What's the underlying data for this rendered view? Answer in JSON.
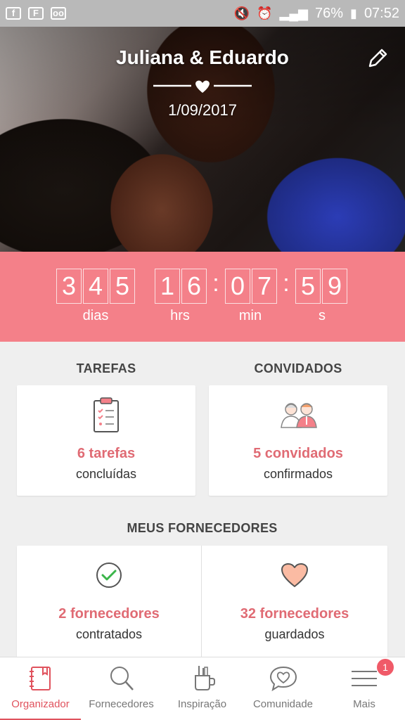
{
  "status_bar": {
    "battery": "76%",
    "time": "07:52",
    "left_icons": [
      "facebook-icon",
      "flipboard-icon",
      "voicemail-icon"
    ],
    "right_icons": [
      "mute-icon",
      "alarm-icon",
      "data-icon",
      "signal-icon",
      "battery-icon"
    ]
  },
  "hero": {
    "couple": "Juliana & Eduardo",
    "date": "1/09/2017"
  },
  "countdown": {
    "days_digits": [
      "3",
      "4",
      "5"
    ],
    "hours_digits": [
      "1",
      "6"
    ],
    "minutes_digits": [
      "0",
      "7"
    ],
    "seconds_digits": [
      "5",
      "9"
    ],
    "labels": {
      "days": "dias",
      "hours": "hrs",
      "minutes": "min",
      "seconds": "s"
    }
  },
  "tasks": {
    "heading": "TAREFAS",
    "main": "6 tarefas",
    "sub": "concluídas"
  },
  "guests": {
    "heading": "CONVIDADOS",
    "main": "5 convidados",
    "sub": "confirmados"
  },
  "vendors": {
    "heading": "MEUS FORNECEDORES",
    "hired_main": "2 fornecedores",
    "hired_sub": "contratados",
    "saved_main": "32 fornecedores",
    "saved_sub": "guardados"
  },
  "nav": {
    "items": [
      {
        "label": "Organizador",
        "icon": "planner-icon"
      },
      {
        "label": "Fornecedores",
        "icon": "search-icon"
      },
      {
        "label": "Inspiração",
        "icon": "inspiration-icon"
      },
      {
        "label": "Comunidade",
        "icon": "community-icon"
      },
      {
        "label": "Mais",
        "icon": "menu-icon"
      }
    ],
    "badge": "1"
  },
  "colors": {
    "accent": "#f48089",
    "accent_text": "#e06b74",
    "nav_active": "#e0525d"
  }
}
